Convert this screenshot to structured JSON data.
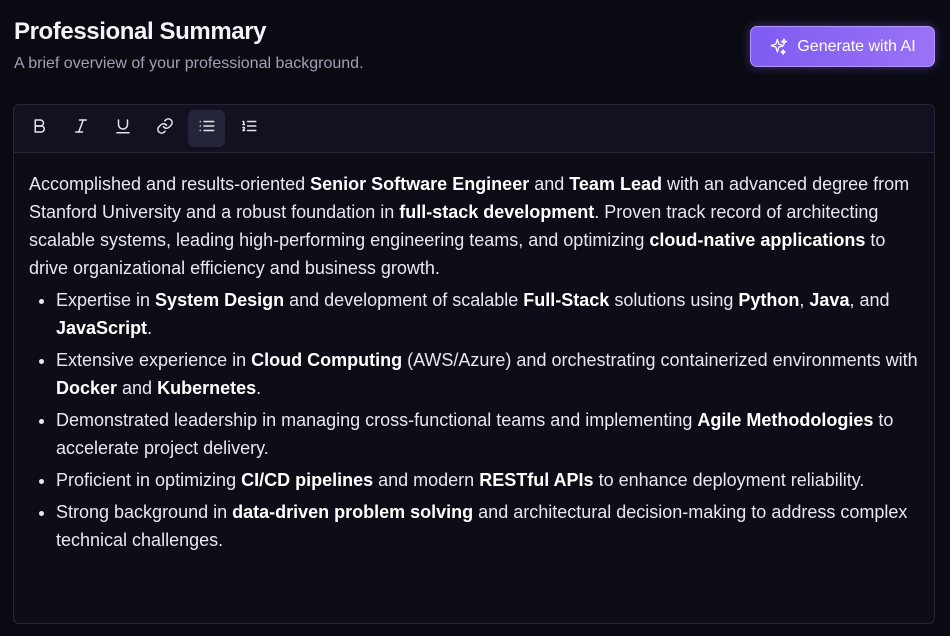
{
  "header": {
    "title": "Professional Summary",
    "subtitle": "A brief overview of your professional background.",
    "ai_button_label": "Generate with AI",
    "ai_button_icon": "sparkles-icon"
  },
  "colors": {
    "background": "#0a0a13",
    "accent": "#8b66f5",
    "editor_border": "#262637"
  },
  "toolbar": {
    "buttons": [
      {
        "name": "bold",
        "icon": "bold-icon",
        "active": false
      },
      {
        "name": "italic",
        "icon": "italic-icon",
        "active": false
      },
      {
        "name": "underline",
        "icon": "underline-icon",
        "active": false
      },
      {
        "name": "link",
        "icon": "link-icon",
        "active": false
      },
      {
        "name": "bullet-list",
        "icon": "bullet-list-icon",
        "active": true
      },
      {
        "name": "numbered-list",
        "icon": "numbered-list-icon",
        "active": false
      }
    ]
  },
  "content": {
    "paragraph": {
      "t1": "Accomplished and results-oriented ",
      "b1": "Senior Software Engineer",
      "t2": " and ",
      "b2": "Team Lead",
      "t3": " with an advanced degree from Stanford University and a robust foundation in ",
      "b3": "full-stack development",
      "t4": ". Proven track record of architecting scalable systems, leading high-performing engineering teams, and optimizing ",
      "b4": "cloud-native applications",
      "t5": " to drive organizational efficiency and business growth."
    },
    "bullets": [
      {
        "t1": "Expertise in ",
        "b1": "System Design",
        "t2": " and development of scalable ",
        "b2": "Full-Stack",
        "t3": " solutions using ",
        "b3": "Python",
        "t4": ", ",
        "b4": "Java",
        "t5": ", and ",
        "b5": "JavaScript",
        "t6": "."
      },
      {
        "t1": "Extensive experience in ",
        "b1": "Cloud Computing",
        "t2": " (AWS/Azure) and orchestrating containerized environments with ",
        "b2": "Docker",
        "t3": " and ",
        "b3": "Kubernetes",
        "t4": "."
      },
      {
        "t1": "Demonstrated leadership in managing cross-functional teams and implementing ",
        "b1": "Agile Methodologies",
        "t2": " to accelerate project delivery."
      },
      {
        "t1": "Proficient in optimizing ",
        "b1": "CI/CD pipelines",
        "t2": " and modern ",
        "b2": "RESTful APIs",
        "t3": " to enhance deployment reliability."
      },
      {
        "t1": "Strong background in ",
        "b1": "data-driven problem solving",
        "t2": " and architectural decision-making to address complex technical challenges."
      }
    ]
  }
}
